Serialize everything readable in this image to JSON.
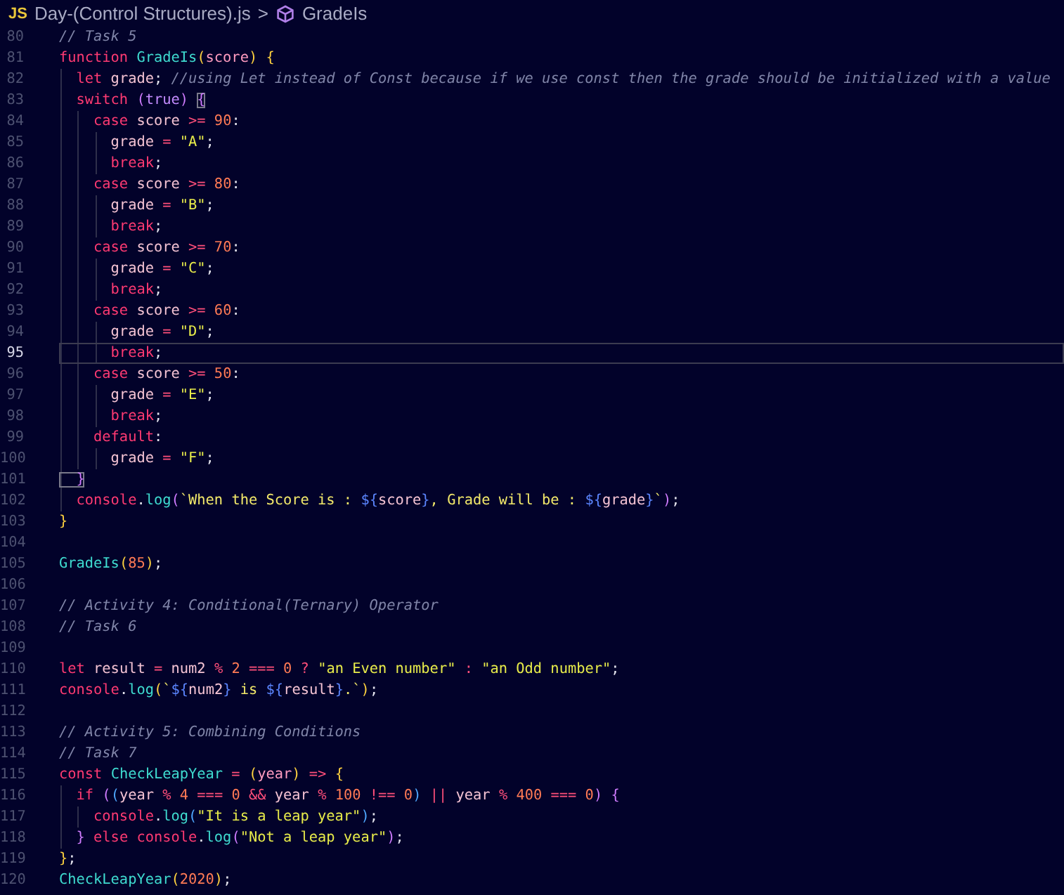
{
  "breadcrumb": {
    "file_badge": "JS",
    "file_name": "Day-(Control Structures).js",
    "separator": ">",
    "symbol": "GradeIs"
  },
  "lines": [
    {
      "number": "80",
      "current": false,
      "tokens": [
        {
          "kind": "comment",
          "text": "// Task 5"
        }
      ]
    },
    {
      "number": "81",
      "current": false,
      "tokens": [
        {
          "kind": "keyword",
          "text": "function "
        },
        {
          "kind": "function",
          "text": "GradeIs"
        },
        {
          "kind": "bracket1",
          "text": "("
        },
        {
          "kind": "param",
          "text": "score"
        },
        {
          "kind": "bracket1",
          "text": ") {"
        }
      ]
    },
    {
      "number": "82",
      "current": false,
      "tokens": [
        {
          "kind": "keyword",
          "text": "  let"
        },
        {
          "kind": "variable",
          "text": " grade"
        },
        {
          "kind": "punct",
          "text": "; "
        },
        {
          "kind": "comment",
          "text": "//using Let instead of Const because if we use const then the grade should be initialized with a value"
        }
      ]
    },
    {
      "number": "83",
      "current": false,
      "tokens": [
        {
          "kind": "keyword",
          "text": "  switch "
        },
        {
          "kind": "bracket2",
          "text": "("
        },
        {
          "kind": "boolean",
          "text": "true"
        },
        {
          "kind": "bracket2",
          "text": ") "
        },
        {
          "kind": "matched_bracket",
          "text": "{"
        }
      ]
    },
    {
      "number": "84",
      "current": false,
      "tokens": [
        {
          "kind": "keyword",
          "text": "    case"
        },
        {
          "kind": "variable",
          "text": " score "
        },
        {
          "kind": "operator",
          "text": ">="
        },
        {
          "kind": "number",
          "text": " 90"
        },
        {
          "kind": "punct",
          "text": ":"
        }
      ]
    },
    {
      "number": "85",
      "current": false,
      "tokens": [
        {
          "kind": "variable",
          "text": "      grade "
        },
        {
          "kind": "operator",
          "text": "="
        },
        {
          "kind": "string",
          "text": " \"A\""
        },
        {
          "kind": "punct",
          "text": ";"
        }
      ]
    },
    {
      "number": "86",
      "current": false,
      "tokens": [
        {
          "kind": "keyword",
          "text": "      break"
        },
        {
          "kind": "punct",
          "text": ";"
        }
      ]
    },
    {
      "number": "87",
      "current": false,
      "tokens": [
        {
          "kind": "keyword",
          "text": "    case"
        },
        {
          "kind": "variable",
          "text": " score "
        },
        {
          "kind": "operator",
          "text": ">="
        },
        {
          "kind": "number",
          "text": " 80"
        },
        {
          "kind": "punct",
          "text": ":"
        }
      ]
    },
    {
      "number": "88",
      "current": false,
      "tokens": [
        {
          "kind": "variable",
          "text": "      grade "
        },
        {
          "kind": "operator",
          "text": "="
        },
        {
          "kind": "string",
          "text": " \"B\""
        },
        {
          "kind": "punct",
          "text": ";"
        }
      ]
    },
    {
      "number": "89",
      "current": false,
      "tokens": [
        {
          "kind": "keyword",
          "text": "      break"
        },
        {
          "kind": "punct",
          "text": ";"
        }
      ]
    },
    {
      "number": "90",
      "current": false,
      "tokens": [
        {
          "kind": "keyword",
          "text": "    case"
        },
        {
          "kind": "variable",
          "text": " score "
        },
        {
          "kind": "operator",
          "text": ">="
        },
        {
          "kind": "number",
          "text": " 70"
        },
        {
          "kind": "punct",
          "text": ":"
        }
      ]
    },
    {
      "number": "91",
      "current": false,
      "tokens": [
        {
          "kind": "variable",
          "text": "      grade "
        },
        {
          "kind": "operator",
          "text": "="
        },
        {
          "kind": "string",
          "text": " \"C\""
        },
        {
          "kind": "punct",
          "text": ";"
        }
      ]
    },
    {
      "number": "92",
      "current": false,
      "tokens": [
        {
          "kind": "keyword",
          "text": "      break"
        },
        {
          "kind": "punct",
          "text": ";"
        }
      ]
    },
    {
      "number": "93",
      "current": false,
      "tokens": [
        {
          "kind": "keyword",
          "text": "    case"
        },
        {
          "kind": "variable",
          "text": " score "
        },
        {
          "kind": "operator",
          "text": ">="
        },
        {
          "kind": "number",
          "text": " 60"
        },
        {
          "kind": "punct",
          "text": ":"
        }
      ]
    },
    {
      "number": "94",
      "current": false,
      "tokens": [
        {
          "kind": "variable",
          "text": "      grade "
        },
        {
          "kind": "operator",
          "text": "="
        },
        {
          "kind": "string",
          "text": " \"D\""
        },
        {
          "kind": "punct",
          "text": ";"
        }
      ]
    },
    {
      "number": "95",
      "current": true,
      "tokens": [
        {
          "kind": "keyword",
          "text": "      break"
        },
        {
          "kind": "punct",
          "text": ";"
        }
      ]
    },
    {
      "number": "96",
      "current": false,
      "tokens": [
        {
          "kind": "keyword",
          "text": "    case"
        },
        {
          "kind": "variable",
          "text": " score "
        },
        {
          "kind": "operator",
          "text": ">="
        },
        {
          "kind": "number",
          "text": " 50"
        },
        {
          "kind": "punct",
          "text": ":"
        }
      ]
    },
    {
      "number": "97",
      "current": false,
      "tokens": [
        {
          "kind": "variable",
          "text": "      grade "
        },
        {
          "kind": "operator",
          "text": "="
        },
        {
          "kind": "string",
          "text": " \"E\""
        },
        {
          "kind": "punct",
          "text": ";"
        }
      ]
    },
    {
      "number": "98",
      "current": false,
      "tokens": [
        {
          "kind": "keyword",
          "text": "      break"
        },
        {
          "kind": "punct",
          "text": ";"
        }
      ]
    },
    {
      "number": "99",
      "current": false,
      "tokens": [
        {
          "kind": "keyword",
          "text": "    default"
        },
        {
          "kind": "punct",
          "text": ":"
        }
      ]
    },
    {
      "number": "100",
      "current": false,
      "tokens": [
        {
          "kind": "variable",
          "text": "      grade "
        },
        {
          "kind": "operator",
          "text": "="
        },
        {
          "kind": "string",
          "text": " \"F\""
        },
        {
          "kind": "punct",
          "text": ";"
        }
      ]
    },
    {
      "number": "101",
      "current": false,
      "tokens": [
        {
          "kind": "matched_bracket",
          "text": "  }"
        }
      ]
    },
    {
      "number": "102",
      "current": false,
      "tokens": [
        {
          "kind": "keyword",
          "text": "  console"
        },
        {
          "kind": "punct",
          "text": "."
        },
        {
          "kind": "function",
          "text": "log"
        },
        {
          "kind": "bracket2",
          "text": "("
        },
        {
          "kind": "template",
          "text": "`When the Score is : "
        },
        {
          "kind": "interpolation",
          "text": "${"
        },
        {
          "kind": "variable",
          "text": "score"
        },
        {
          "kind": "interpolation",
          "text": "}"
        },
        {
          "kind": "template",
          "text": ", Grade will be : "
        },
        {
          "kind": "interpolation",
          "text": "${"
        },
        {
          "kind": "variable",
          "text": "grade"
        },
        {
          "kind": "interpolation",
          "text": "}"
        },
        {
          "kind": "template",
          "text": "`"
        },
        {
          "kind": "bracket2",
          "text": ")"
        },
        {
          "kind": "punct",
          "text": ";"
        }
      ]
    },
    {
      "number": "103",
      "current": false,
      "tokens": [
        {
          "kind": "bracket1",
          "text": "}"
        }
      ]
    },
    {
      "number": "104",
      "current": false
    },
    {
      "number": "105",
      "current": false,
      "tokens": [
        {
          "kind": "function",
          "text": "GradeIs"
        },
        {
          "kind": "bracket1",
          "text": "("
        },
        {
          "kind": "number",
          "text": "85"
        },
        {
          "kind": "bracket1",
          "text": ")"
        },
        {
          "kind": "punct",
          "text": ";"
        }
      ]
    },
    {
      "number": "106",
      "current": false
    },
    {
      "number": "107",
      "current": false,
      "tokens": [
        {
          "kind": "comment",
          "text": "// Activity 4: Conditional(Ternary) Operator"
        }
      ]
    },
    {
      "number": "108",
      "current": false,
      "tokens": [
        {
          "kind": "comment",
          "text": "// Task 6"
        }
      ]
    },
    {
      "number": "109",
      "current": false
    },
    {
      "number": "110",
      "current": false,
      "tokens": [
        {
          "kind": "keyword",
          "text": "let"
        },
        {
          "kind": "variable",
          "text": " result "
        },
        {
          "kind": "operator",
          "text": "="
        },
        {
          "kind": "variable",
          "text": " num2 "
        },
        {
          "kind": "operator",
          "text": "%"
        },
        {
          "kind": "number",
          "text": " 2 "
        },
        {
          "kind": "operator",
          "text": "==="
        },
        {
          "kind": "number",
          "text": " 0 "
        },
        {
          "kind": "operator",
          "text": "?"
        },
        {
          "kind": "string",
          "text": " \"an Even number\" "
        },
        {
          "kind": "operator",
          "text": ":"
        },
        {
          "kind": "string",
          "text": " \"an Odd number\""
        },
        {
          "kind": "punct",
          "text": ";"
        }
      ]
    },
    {
      "number": "111",
      "current": false,
      "tokens": [
        {
          "kind": "keyword",
          "text": "console"
        },
        {
          "kind": "punct",
          "text": "."
        },
        {
          "kind": "function",
          "text": "log"
        },
        {
          "kind": "bracket1",
          "text": "("
        },
        {
          "kind": "template",
          "text": "`"
        },
        {
          "kind": "interpolation",
          "text": "${"
        },
        {
          "kind": "variable",
          "text": "num2"
        },
        {
          "kind": "interpolation",
          "text": "}"
        },
        {
          "kind": "template",
          "text": " is "
        },
        {
          "kind": "interpolation",
          "text": "${"
        },
        {
          "kind": "variable",
          "text": "result"
        },
        {
          "kind": "interpolation",
          "text": "}"
        },
        {
          "kind": "template",
          "text": ".`"
        },
        {
          "kind": "bracket1",
          "text": ")"
        },
        {
          "kind": "punct",
          "text": ";"
        }
      ]
    },
    {
      "number": "112",
      "current": false
    },
    {
      "number": "113",
      "current": false,
      "tokens": [
        {
          "kind": "comment",
          "text": "// Activity 5: Combining Conditions"
        }
      ]
    },
    {
      "number": "114",
      "current": false,
      "tokens": [
        {
          "kind": "comment",
          "text": "// Task 7"
        }
      ]
    },
    {
      "number": "115",
      "current": false,
      "tokens": [
        {
          "kind": "keyword",
          "text": "const "
        },
        {
          "kind": "function",
          "text": "CheckLeapYear"
        },
        {
          "kind": "operator",
          "text": " = "
        },
        {
          "kind": "bracket1",
          "text": "("
        },
        {
          "kind": "param",
          "text": "year"
        },
        {
          "kind": "bracket1",
          "text": ")"
        },
        {
          "kind": "operator",
          "text": " => "
        },
        {
          "kind": "bracket1",
          "text": "{"
        }
      ]
    },
    {
      "number": "116",
      "current": false,
      "tokens": [
        {
          "kind": "keyword",
          "text": "  if "
        },
        {
          "kind": "bracket2",
          "text": "("
        },
        {
          "kind": "bracket3",
          "text": "("
        },
        {
          "kind": "variable",
          "text": "year "
        },
        {
          "kind": "operator",
          "text": "%"
        },
        {
          "kind": "number",
          "text": " 4 "
        },
        {
          "kind": "operator",
          "text": "==="
        },
        {
          "kind": "number",
          "text": " 0 "
        },
        {
          "kind": "operator",
          "text": "&&"
        },
        {
          "kind": "variable",
          "text": " year "
        },
        {
          "kind": "operator",
          "text": "%"
        },
        {
          "kind": "number",
          "text": " 100 "
        },
        {
          "kind": "operator",
          "text": "!=="
        },
        {
          "kind": "number",
          "text": " 0"
        },
        {
          "kind": "bracket3",
          "text": ")"
        },
        {
          "kind": "operator",
          "text": " || "
        },
        {
          "kind": "variable",
          "text": "year "
        },
        {
          "kind": "operator",
          "text": "%"
        },
        {
          "kind": "number",
          "text": " 400 "
        },
        {
          "kind": "operator",
          "text": "==="
        },
        {
          "kind": "number",
          "text": " 0"
        },
        {
          "kind": "bracket2",
          "text": ") {"
        }
      ]
    },
    {
      "number": "117",
      "current": false,
      "tokens": [
        {
          "kind": "keyword",
          "text": "    console"
        },
        {
          "kind": "punct",
          "text": "."
        },
        {
          "kind": "function",
          "text": "log"
        },
        {
          "kind": "bracket3",
          "text": "("
        },
        {
          "kind": "string",
          "text": "\"It is a leap year\""
        },
        {
          "kind": "bracket3",
          "text": ")"
        },
        {
          "kind": "punct",
          "text": ";"
        }
      ]
    },
    {
      "number": "118",
      "current": false,
      "tokens": [
        {
          "kind": "bracket2",
          "text": "  }"
        },
        {
          "kind": "keyword",
          "text": " else console"
        },
        {
          "kind": "punct",
          "text": "."
        },
        {
          "kind": "function",
          "text": "log"
        },
        {
          "kind": "bracket2",
          "text": "("
        },
        {
          "kind": "string",
          "text": "\"Not a leap year\""
        },
        {
          "kind": "bracket2",
          "text": ")"
        },
        {
          "kind": "punct",
          "text": ";"
        }
      ]
    },
    {
      "number": "119",
      "current": false,
      "tokens": [
        {
          "kind": "bracket1",
          "text": "}"
        },
        {
          "kind": "punct",
          "text": ";"
        }
      ]
    },
    {
      "number": "120",
      "current": false,
      "tokens": [
        {
          "kind": "function",
          "text": "CheckLeapYear"
        },
        {
          "kind": "bracket1",
          "text": "("
        },
        {
          "kind": "number",
          "text": "2020"
        },
        {
          "kind": "bracket1",
          "text": ")"
        },
        {
          "kind": "punct",
          "text": ";"
        }
      ]
    }
  ]
}
